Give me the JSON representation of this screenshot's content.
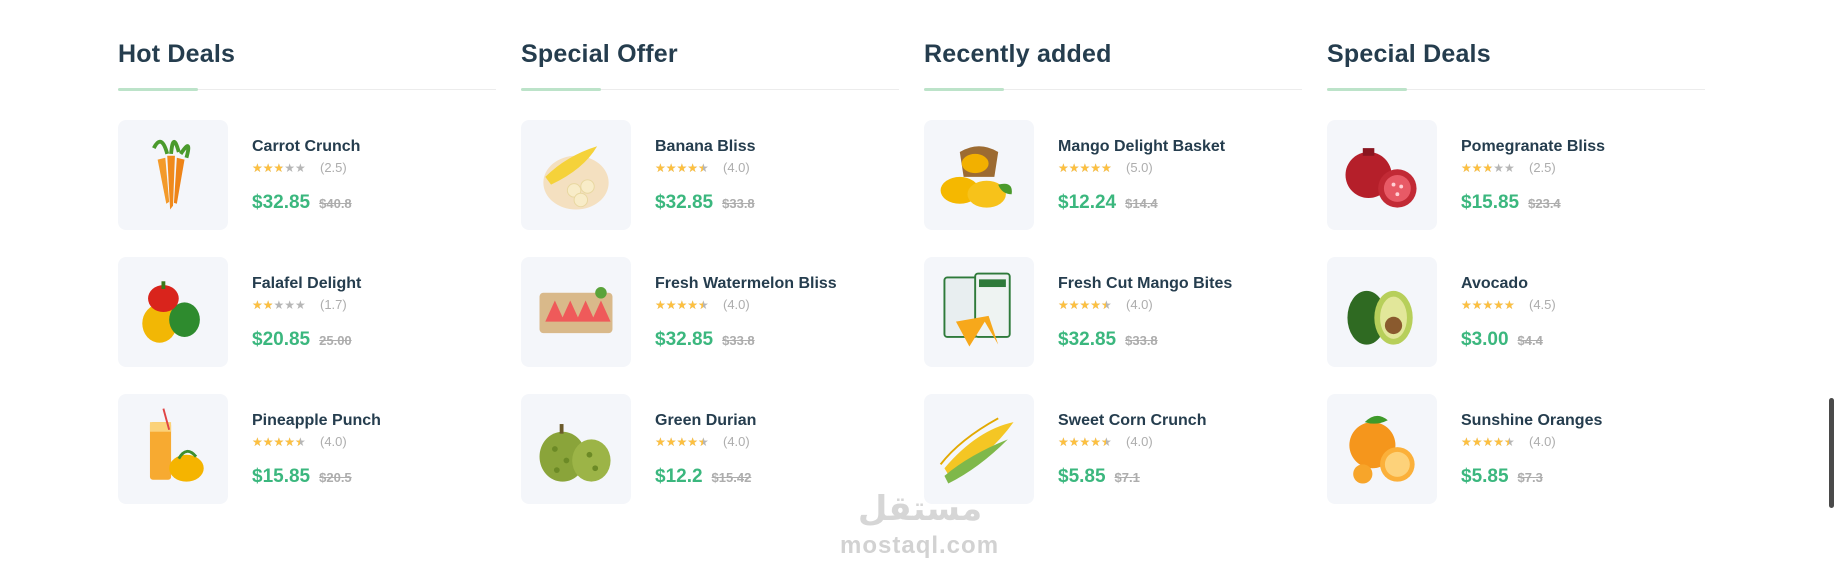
{
  "columns": [
    {
      "title": "Hot Deals",
      "items": [
        {
          "name": "Carrot Crunch",
          "rating": 2.5,
          "rating_text": "(2.5)",
          "price": "$32.85",
          "old_price": "$40.8",
          "icon": "carrot-icon"
        },
        {
          "name": "Falafel Delight",
          "rating": 1.7,
          "rating_text": "(1.7)",
          "price": "$20.85",
          "old_price": "25.00",
          "icon": "bell-pepper-icon"
        },
        {
          "name": "Pineapple Punch",
          "rating": 4.0,
          "rating_text": "(4.0)",
          "price": "$15.85",
          "old_price": "$20.5",
          "icon": "juice-glass-icon"
        }
      ]
    },
    {
      "title": "Special Offer",
      "items": [
        {
          "name": "Banana Bliss",
          "rating": 4.0,
          "rating_text": "(4.0)",
          "price": "$32.85",
          "old_price": "$33.8",
          "icon": "banana-icon"
        },
        {
          "name": "Fresh Watermelon Bliss",
          "rating": 4.0,
          "rating_text": "(4.0)",
          "price": "$32.85",
          "old_price": "$33.8",
          "icon": "watermelon-slices-icon"
        },
        {
          "name": "Green Durian",
          "rating": 4.0,
          "rating_text": "(4.0)",
          "price": "$12.2",
          "old_price": "$15.42",
          "icon": "durian-icon"
        }
      ]
    },
    {
      "title": "Recently added",
      "items": [
        {
          "name": "Mango Delight Basket",
          "rating": 5.0,
          "rating_text": "(5.0)",
          "price": "$12.24",
          "old_price": "$14.4",
          "icon": "mango-basket-icon"
        },
        {
          "name": "Fresh Cut Mango Bites",
          "rating": 4.0,
          "rating_text": "(4.0)",
          "price": "$32.85",
          "old_price": "$33.8",
          "icon": "mango-pack-icon"
        },
        {
          "name": "Sweet Corn Crunch",
          "rating": 4.0,
          "rating_text": "(4.0)",
          "price": "$5.85",
          "old_price": "$7.1",
          "icon": "corn-icon"
        }
      ]
    },
    {
      "title": "Special Deals",
      "items": [
        {
          "name": "Pomegranate Bliss",
          "rating": 2.5,
          "rating_text": "(2.5)",
          "price": "$15.85",
          "old_price": "$23.4",
          "icon": "pomegranate-icon"
        },
        {
          "name": "Avocado",
          "rating": 4.5,
          "rating_text": "(4.5)",
          "price": "$3.00",
          "old_price": "$4.4",
          "icon": "avocado-icon"
        },
        {
          "name": "Sunshine Oranges",
          "rating": 4.0,
          "rating_text": "(4.0)",
          "price": "$5.85",
          "old_price": "$7.3",
          "icon": "orange-icon"
        }
      ]
    }
  ],
  "watermark": {
    "arabic": "مستقل",
    "latin": "mostaql.com"
  },
  "colors": {
    "heading": "#253d4e",
    "price": "#3bb77e",
    "old_price": "#adadad",
    "star": "#fdc040",
    "accent_rule": "#bce3c9",
    "thumb_bg": "#f4f6fa"
  }
}
